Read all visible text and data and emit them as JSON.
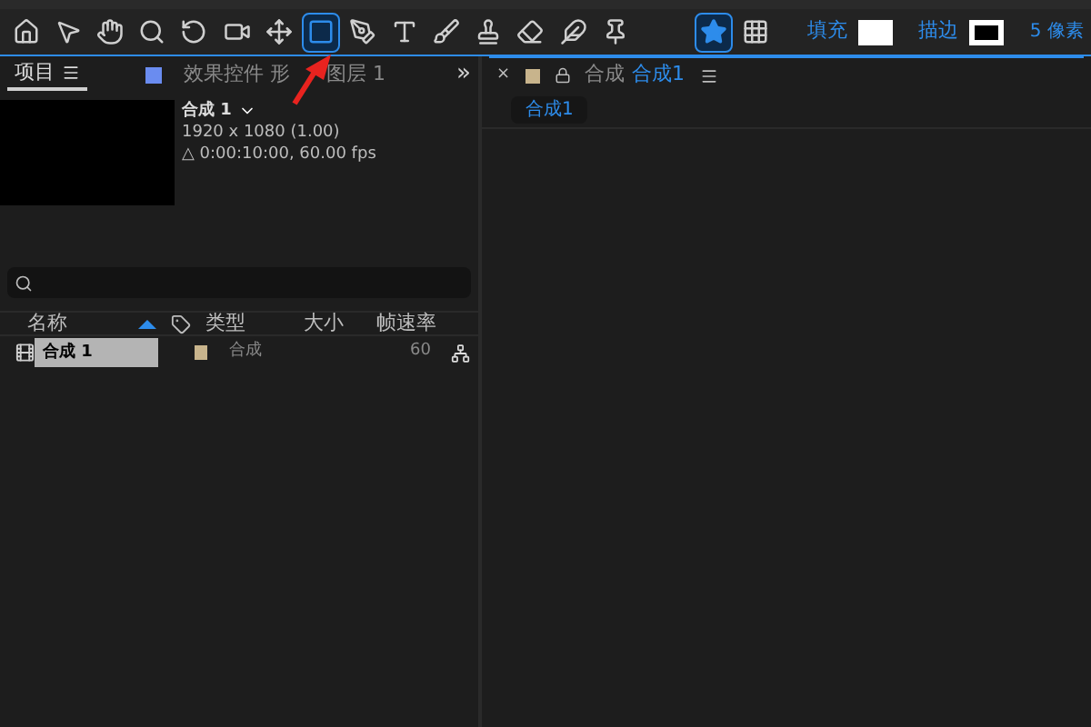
{
  "toolbar": {
    "tools": [
      {
        "kind": "home",
        "selected": false
      },
      {
        "kind": "select",
        "selected": false
      },
      {
        "kind": "hand",
        "selected": false
      },
      {
        "kind": "zoom",
        "selected": false
      },
      {
        "kind": "rotate",
        "selected": false
      },
      {
        "kind": "camera",
        "selected": false
      },
      {
        "kind": "pan",
        "selected": false
      },
      {
        "kind": "rectangle",
        "selected": true
      },
      {
        "kind": "pen",
        "selected": false
      },
      {
        "kind": "text",
        "selected": false
      },
      {
        "kind": "brush",
        "selected": false
      },
      {
        "kind": "stamp",
        "selected": false
      },
      {
        "kind": "eraser",
        "selected": false
      },
      {
        "kind": "roto",
        "selected": false
      },
      {
        "kind": "pin",
        "selected": false
      }
    ],
    "mask_modes": [
      {
        "kind": "star",
        "selected": true
      },
      {
        "kind": "dotted",
        "selected": false
      }
    ],
    "fill_label": "填充",
    "stroke_label": "描边",
    "stroke_width": "5 像素"
  },
  "left_panel": {
    "tabs": [
      {
        "label": "项目",
        "selected": true
      },
      {
        "label_parts": [
          "效果控件 形",
          "图层 1"
        ],
        "selected": false
      }
    ],
    "more": "»",
    "info": {
      "name": "合成 1",
      "size": "1920 x 1080 (1.00)",
      "duration": "△ 0:00:10:00, 60.00 fps"
    },
    "columns": [
      "名称",
      "类型",
      "大小",
      "帧速率"
    ],
    "rows": [
      {
        "name": "合成 1",
        "type": "合成",
        "fps": "60",
        "selected": true
      }
    ]
  },
  "right_panel": {
    "close": "×",
    "tab_prefix": "合成",
    "tab_name": "合成1",
    "sub_tabs": [
      {
        "label": "合成1",
        "selected": true
      }
    ]
  }
}
